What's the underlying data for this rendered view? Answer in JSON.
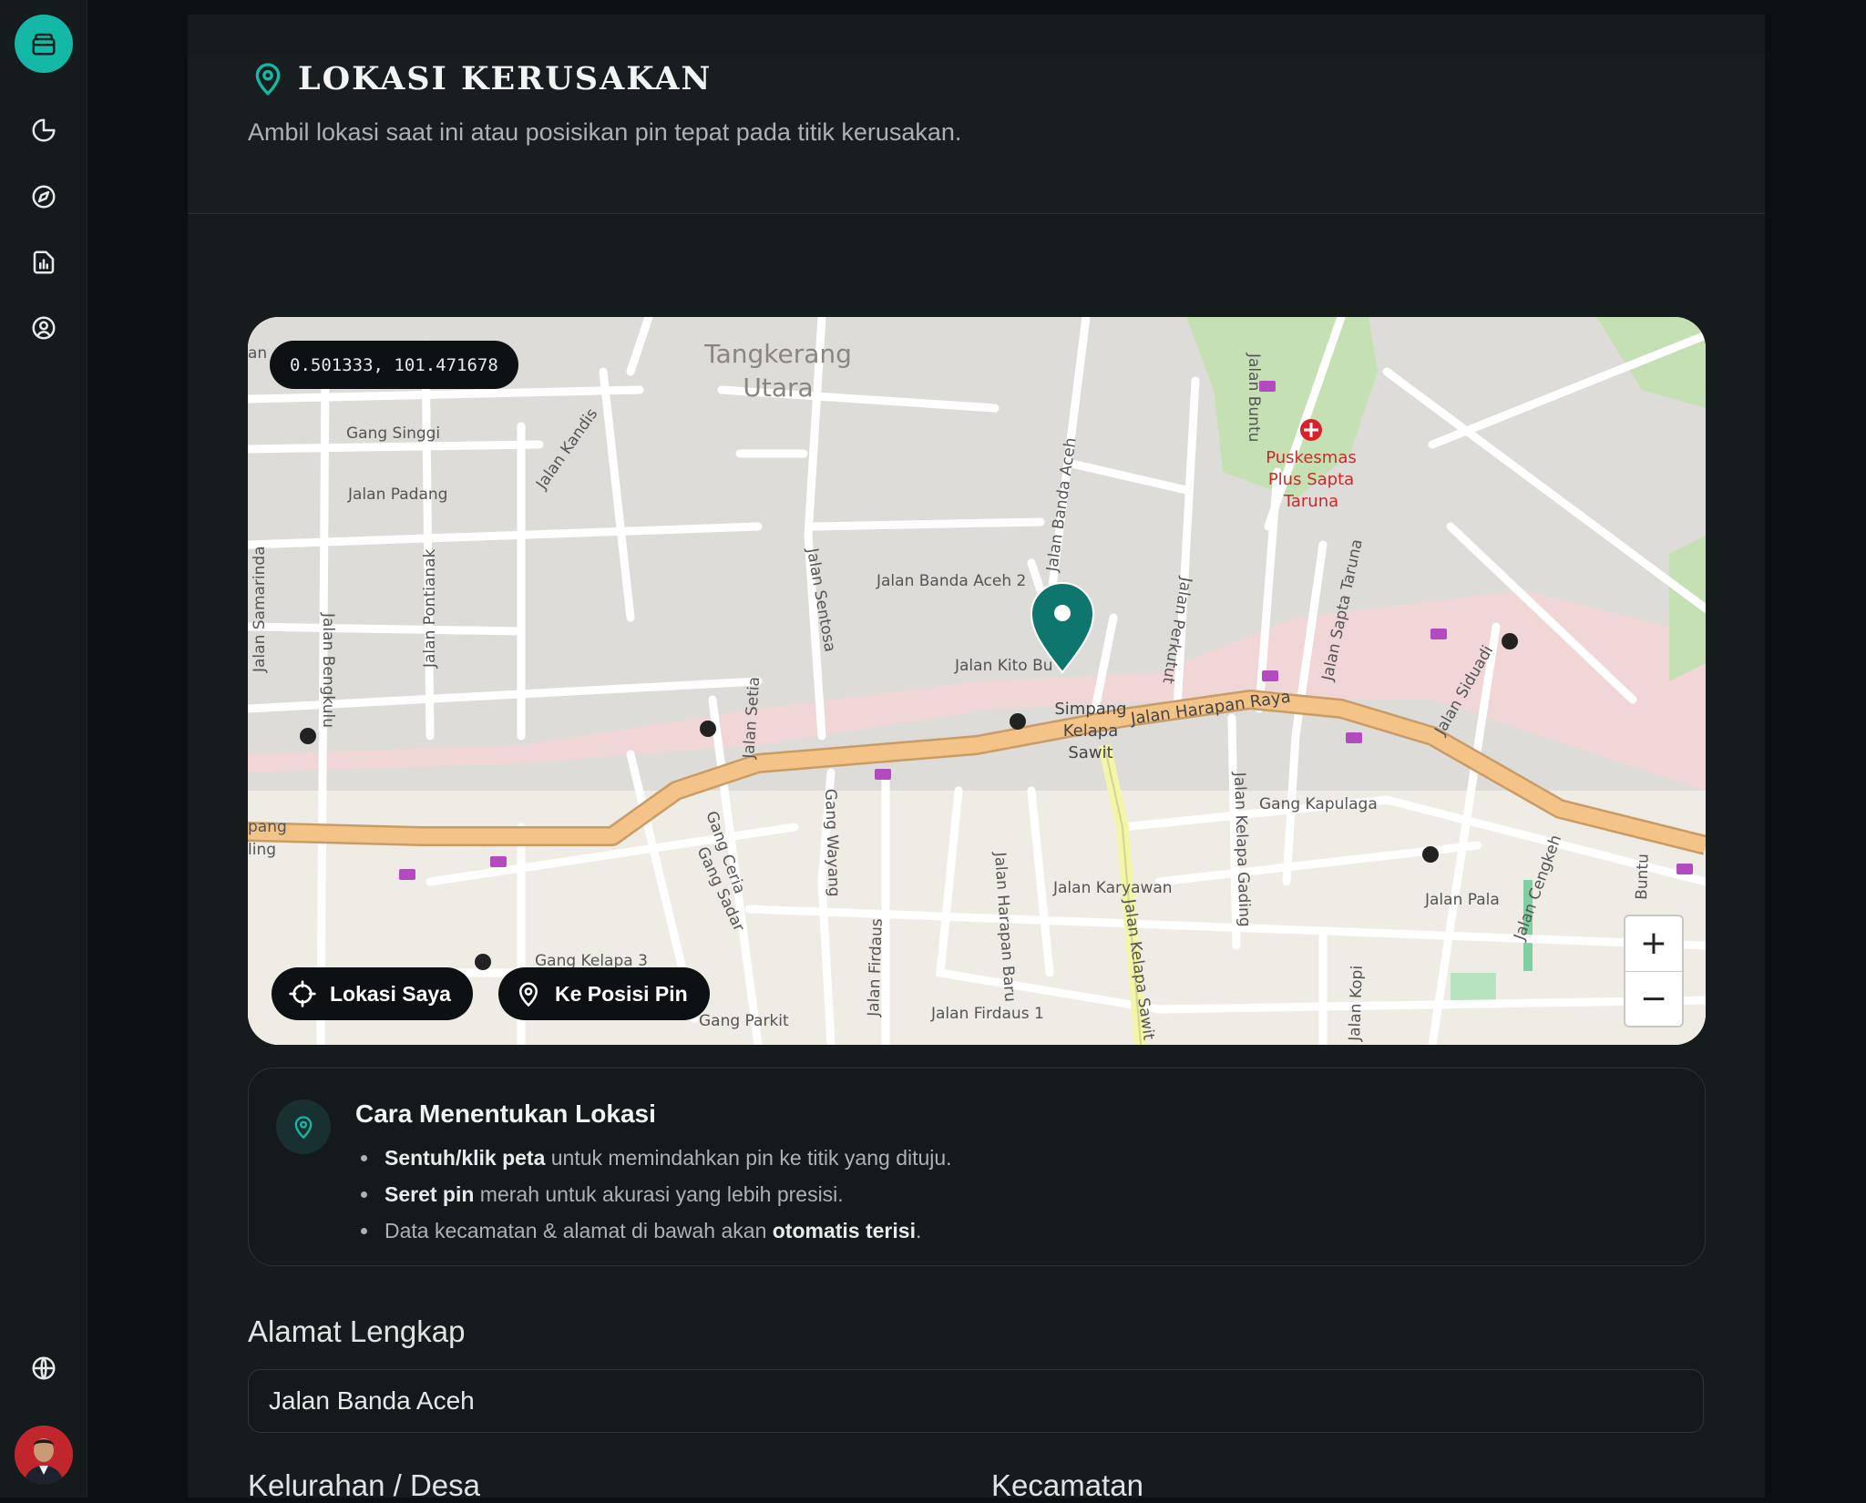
{
  "sidebar": {
    "logo": "wallet-icon",
    "nav": [
      "chart-pie-icon",
      "compass-icon",
      "report-icon",
      "user-circle-icon"
    ],
    "bottom": [
      "globe-icon"
    ],
    "avatar": "user-avatar"
  },
  "header": {
    "title": "LOKASI KERUSAKAN",
    "subtitle": "Ambil lokasi saat ini atau posisikan pin tepat pada titik kerusakan."
  },
  "map": {
    "coordinates": "0.501333, 101.471678",
    "my_location_label": "Lokasi Saya",
    "to_pin_label": "Ke Posisi Pin",
    "zoom_in": "+",
    "zoom_out": "−",
    "labels": {
      "district": "Tangkerang Utara",
      "district_1": "Tangkerang",
      "district_2": "Utara",
      "gang_singgi": "Gang Singgi",
      "jalan_padang": "Jalan Padang",
      "jalan_kandis": "Jalan Kandis",
      "jalan_samarinda": "Jalan Samarinda",
      "jalan_bengkulu": "Jalan Bengkulu",
      "jalan_pontianak": "Jalan Pontianak",
      "jalan_sentosa": "Jalan Sentosa",
      "jalan_banda_aceh_2": "Jalan Banda Aceh 2",
      "jalan_banda_aceh": "Jalan Banda Aceh",
      "jalan_kito": "Jalan Kito Bu",
      "jalan_buntu": "Jalan Buntu",
      "puskesmas_1": "Puskesmas",
      "puskesmas_2": "Plus Sapta",
      "puskesmas_3": "Taruna",
      "jalan_sapta_taruna": "Jalan Sapta Taruna",
      "jalan_perkutut": "Jalan Perkutut",
      "jalan_siduadi": "Jalan Siduadi",
      "simpang_1": "Simpang",
      "simpang_2": "Kelapa",
      "simpang_3": "Sawit",
      "jalan_harapan_raya": "Jalan Harapan Raya",
      "jalan_setia": "Jalan Setia",
      "gang_ceria": "Gang Ceria",
      "gang_sadar": "Gang Sadar",
      "gang_wayang": "Gang Wayang",
      "jalan_harapan_baru": "Jalan Harapan Baru",
      "jalan_karyawan": "Jalan Karyawan",
      "jalan_kelapa_sawit": "Jalan Kelapa Sawit",
      "jalan_kelapa_gading": "Jalan Kelapa Gading",
      "gang_kapulaga": "Gang Kapulaga",
      "jalan_pala": "Jalan Pala",
      "jalan_cengkeh": "Jalan Cengkeh",
      "jalan_firdaus": "Jalan Firdaus",
      "jalan_firdaus_1": "Jalan Firdaus 1",
      "gang_kelapa_3": "Gang Kelapa 3",
      "gang_parkit": "Gang Parkit",
      "jalan_kopi": "Jalan Kopi",
      "buntu": "Buntu",
      "pang": "pang",
      "ling": "ling",
      "an": "an"
    }
  },
  "info": {
    "title": "Cara Menentukan Lokasi",
    "item1_bold": "Sentuh/klik peta",
    "item1_rest": " untuk memindahkan pin ke titik yang dituju.",
    "item2_bold": "Seret pin",
    "item2_rest": " merah untuk akurasi yang lebih presisi.",
    "item3_pre": "Data kecamatan & alamat di bawah akan ",
    "item3_bold": "otomatis terisi",
    "item3_post": "."
  },
  "form": {
    "address_label": "Alamat Lengkap",
    "address_value": "Jalan Banda Aceh",
    "kelurahan_label": "Kelurahan / Desa",
    "kecamatan_label": "Kecamatan"
  },
  "colors": {
    "accent": "#14b8a6",
    "pin": "#0f766e",
    "main_road": "#f3c387",
    "background": "#0d1012"
  }
}
